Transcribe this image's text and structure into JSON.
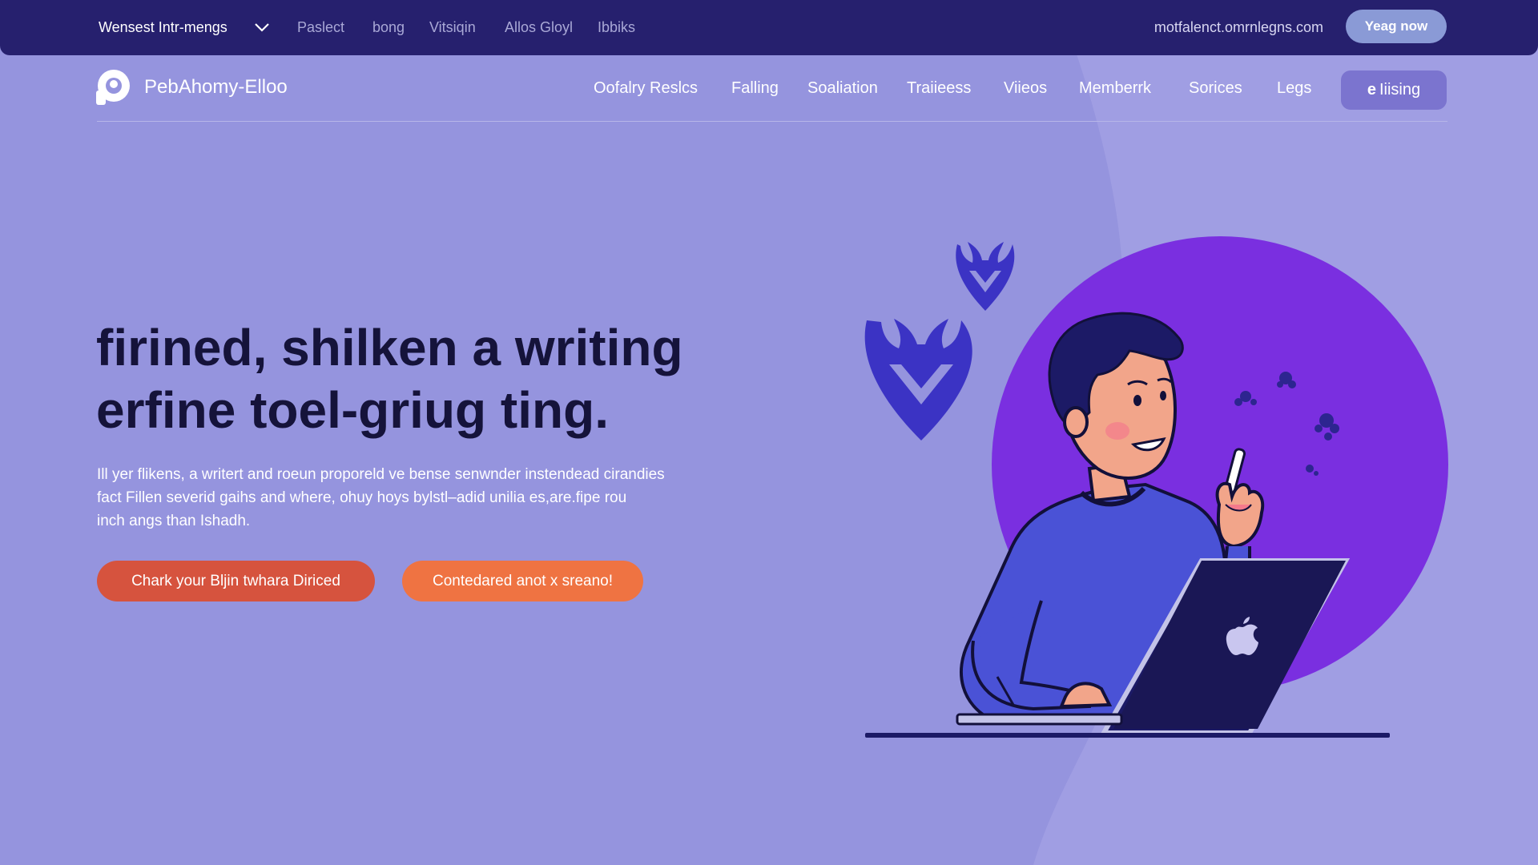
{
  "topbar": {
    "items": [
      "Wensest Intr-mengs",
      "Paslect",
      "bong",
      "Vitsiqin",
      "Allos Gloyl",
      "Ibbiks"
    ],
    "email": "motfalenct.omrnlegns.com",
    "cta_label": "Yeag now"
  },
  "header": {
    "brand": "PebAhomy-Elloo",
    "nav": [
      "Oofalry Reslcs",
      "Falling",
      "Soaliation",
      "Traiieess",
      "Viieos",
      "Memberrk",
      "Sorices",
      "Legs"
    ],
    "cta_icon": "e",
    "cta_label": "Iiising"
  },
  "hero": {
    "title_lines": [
      "firined, shilken a writing",
      "erfine toel-griug ting."
    ],
    "body_lines": [
      "Ill yer flikens, a writert and roeun proporeld ve bense senwnder instendead cirandies",
      "fact Fillen severid gaihs and where, ohuy hoys bylstl–adid unilia es,are.fipe rou",
      "inch angs than Ishadh."
    ],
    "primary_cta": "Chark your Bljin twhara Diriced",
    "secondary_cta": "Contedared anot x sreano!"
  },
  "icons": {
    "logo": "circle-logo-icon",
    "dropdown": "chevron-down-icon",
    "laptop_brand": "apple-icon",
    "decor": "horned-shield-icon"
  },
  "colors": {
    "background": "#9594de",
    "topbar": "#26206e",
    "title_text": "#15133a",
    "primary_cta": "#d6533e",
    "secondary_cta": "#ef7342",
    "accent_purple": "#7a2fe0",
    "sweater_blue": "#4a52d6"
  }
}
